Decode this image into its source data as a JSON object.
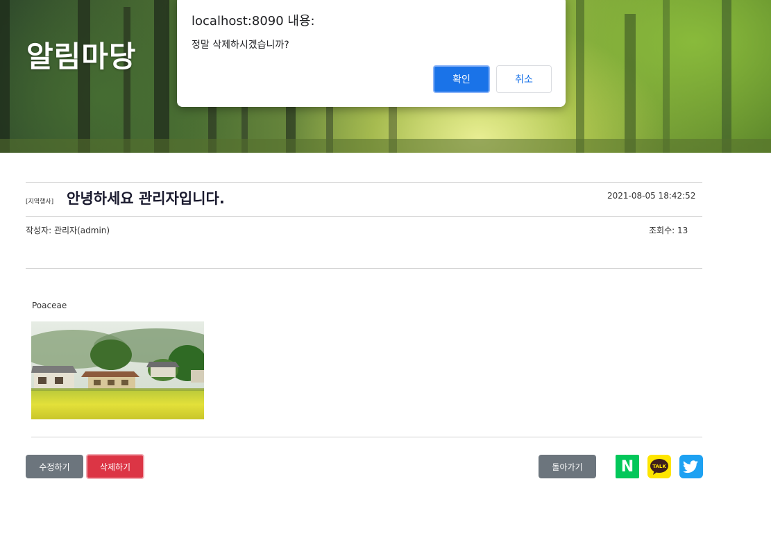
{
  "hero": {
    "title": "알림마당"
  },
  "dialog": {
    "title": "localhost:8090 내용:",
    "message": "정말 삭제하시겠습니까?",
    "ok_label": "확인",
    "cancel_label": "취소"
  },
  "post": {
    "category": "[지역행사]",
    "title": "안녕하세요 관리자입니다.",
    "date": "2021-08-05 18:42:52",
    "author": "작성자: 관리자(admin)",
    "views": "조회수: 13",
    "caption": "Poaceae"
  },
  "actions": {
    "edit_label": "수정하기",
    "delete_label": "삭제하기",
    "back_label": "돌아가기"
  },
  "share": {
    "naver_letter": "N",
    "kakao_text": "TALK",
    "icons": [
      "naver-icon",
      "kakaotalk-icon",
      "twitter-icon"
    ]
  },
  "colors": {
    "confirm_blue": "#1a73e8",
    "button_gray": "#6c757d",
    "button_red": "#dc3545",
    "naver_green": "#03c75a",
    "kakao_yellow": "#fee500",
    "twitter_blue": "#1da1f2"
  }
}
